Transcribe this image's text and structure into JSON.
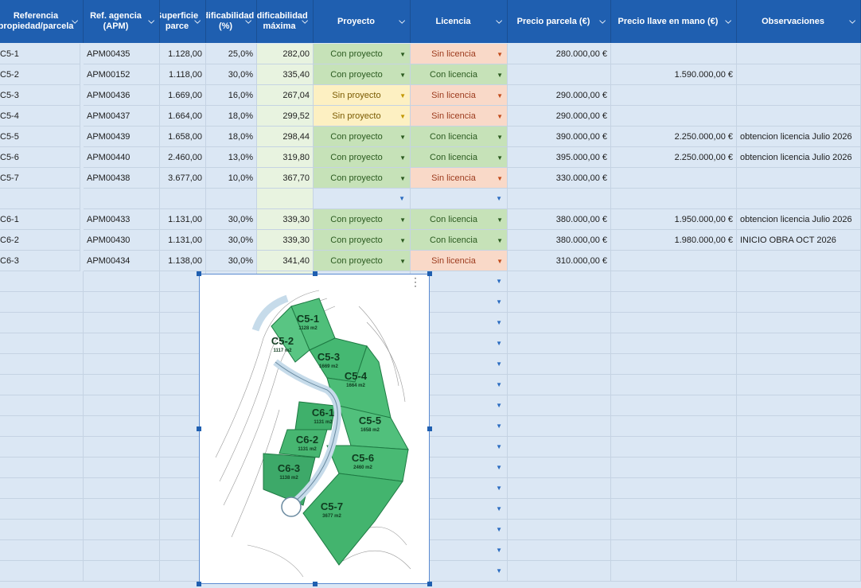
{
  "headers": {
    "referencia": "Referencia propiedad/parcela",
    "ref_agencia": "Ref. agencia (APM)",
    "superficie": "Superficie parce",
    "edificabilidad": "Edificabilidad (%)",
    "edif_maxima": "Edificabilidad máxima",
    "proyecto": "Proyecto",
    "licencia": "Licencia",
    "precio_parcela": "Precio parcela (€)",
    "precio_llave": "Precio llave en mano (€)",
    "observaciones": "Observaciones"
  },
  "rows": [
    {
      "ref": "C5-1",
      "apm": "APM00435",
      "sup": "1.128,00",
      "edif": "25,0%",
      "max": "282,00",
      "proyecto": "Con proyecto",
      "licencia": "Sin licencia",
      "precio": "280.000,00 €",
      "llave": "",
      "obs": ""
    },
    {
      "ref": "C5-2",
      "apm": "APM00152",
      "sup": "1.118,00",
      "edif": "30,0%",
      "max": "335,40",
      "proyecto": "Con proyecto",
      "licencia": "Con licencia",
      "precio": "",
      "llave": "1.590.000,00 €",
      "obs": ""
    },
    {
      "ref": "C5-3",
      "apm": "APM00436",
      "sup": "1.669,00",
      "edif": "16,0%",
      "max": "267,04",
      "proyecto": "Sin proyecto",
      "licencia": "Sin licencia",
      "precio": "290.000,00 €",
      "llave": "",
      "obs": ""
    },
    {
      "ref": "C5-4",
      "apm": "APM00437",
      "sup": "1.664,00",
      "edif": "18,0%",
      "max": "299,52",
      "proyecto": "Sin proyecto",
      "licencia": "Sin licencia",
      "precio": "290.000,00 €",
      "llave": "",
      "obs": ""
    },
    {
      "ref": "C5-5",
      "apm": "APM00439",
      "sup": "1.658,00",
      "edif": "18,0%",
      "max": "298,44",
      "proyecto": "Con proyecto",
      "licencia": "Con licencia",
      "precio": "390.000,00 €",
      "llave": "2.250.000,00 €",
      "obs": "obtencion licencia Julio 2026"
    },
    {
      "ref": "C5-6",
      "apm": "APM00440",
      "sup": "2.460,00",
      "edif": "13,0%",
      "max": "319,80",
      "proyecto": "Con proyecto",
      "licencia": "Con licencia",
      "precio": "395.000,00 €",
      "llave": "2.250.000,00 €",
      "obs": "obtencion licencia Julio 2026"
    },
    {
      "ref": "C5-7",
      "apm": "APM00438",
      "sup": "3.677,00",
      "edif": "10,0%",
      "max": "367,70",
      "proyecto": "Con proyecto",
      "licencia": "Sin licencia",
      "precio": "330.000,00 €",
      "llave": "",
      "obs": ""
    },
    {
      "ref": "",
      "apm": "",
      "sup": "",
      "edif": "",
      "max": "",
      "proyecto": "",
      "licencia": "",
      "precio": "",
      "llave": "",
      "obs": ""
    },
    {
      "ref": "C6-1",
      "apm": "APM00433",
      "sup": "1.131,00",
      "edif": "30,0%",
      "max": "339,30",
      "proyecto": "Con proyecto",
      "licencia": "Con licencia",
      "precio": "380.000,00 €",
      "llave": "1.950.000,00 €",
      "obs": "obtencion licencia Julio 2026"
    },
    {
      "ref": "C6-2",
      "apm": "APM00430",
      "sup": "1.131,00",
      "edif": "30,0%",
      "max": "339,30",
      "proyecto": "Con proyecto",
      "licencia": "Con licencia",
      "precio": "380.000,00 €",
      "llave": "1.980.000,00 €",
      "obs": "INICIO OBRA OCT 2026"
    },
    {
      "ref": "C6-3",
      "apm": "APM00434",
      "sup": "1.138,00",
      "edif": "30,0%",
      "max": "341,40",
      "proyecto": "Con proyecto",
      "licencia": "Sin licencia",
      "precio": "310.000,00 €",
      "llave": "",
      "obs": ""
    }
  ],
  "map": {
    "plots": [
      {
        "id": "C5-1",
        "area": "1128 m2"
      },
      {
        "id": "C5-2",
        "area": "1117 m2"
      },
      {
        "id": "C5-3",
        "area": "1669 m2"
      },
      {
        "id": "C5-4",
        "area": "1664 m2"
      },
      {
        "id": "C5-5",
        "area": "1658 m2"
      },
      {
        "id": "C5-6",
        "area": "2460 m2"
      },
      {
        "id": "C5-7",
        "area": "3677 m2"
      },
      {
        "id": "C6-1",
        "area": "1131 m2"
      },
      {
        "id": "C6-2",
        "area": "1131 m2"
      },
      {
        "id": "C6-3",
        "area": "1138 m2"
      }
    ]
  },
  "colors": {
    "header": "#1f5fb0",
    "green_chip": "#c6e2b8",
    "red_chip": "#f9d9c8",
    "yellow_chip": "#fdf0c2",
    "sheet_bg": "#dbe7f4"
  }
}
